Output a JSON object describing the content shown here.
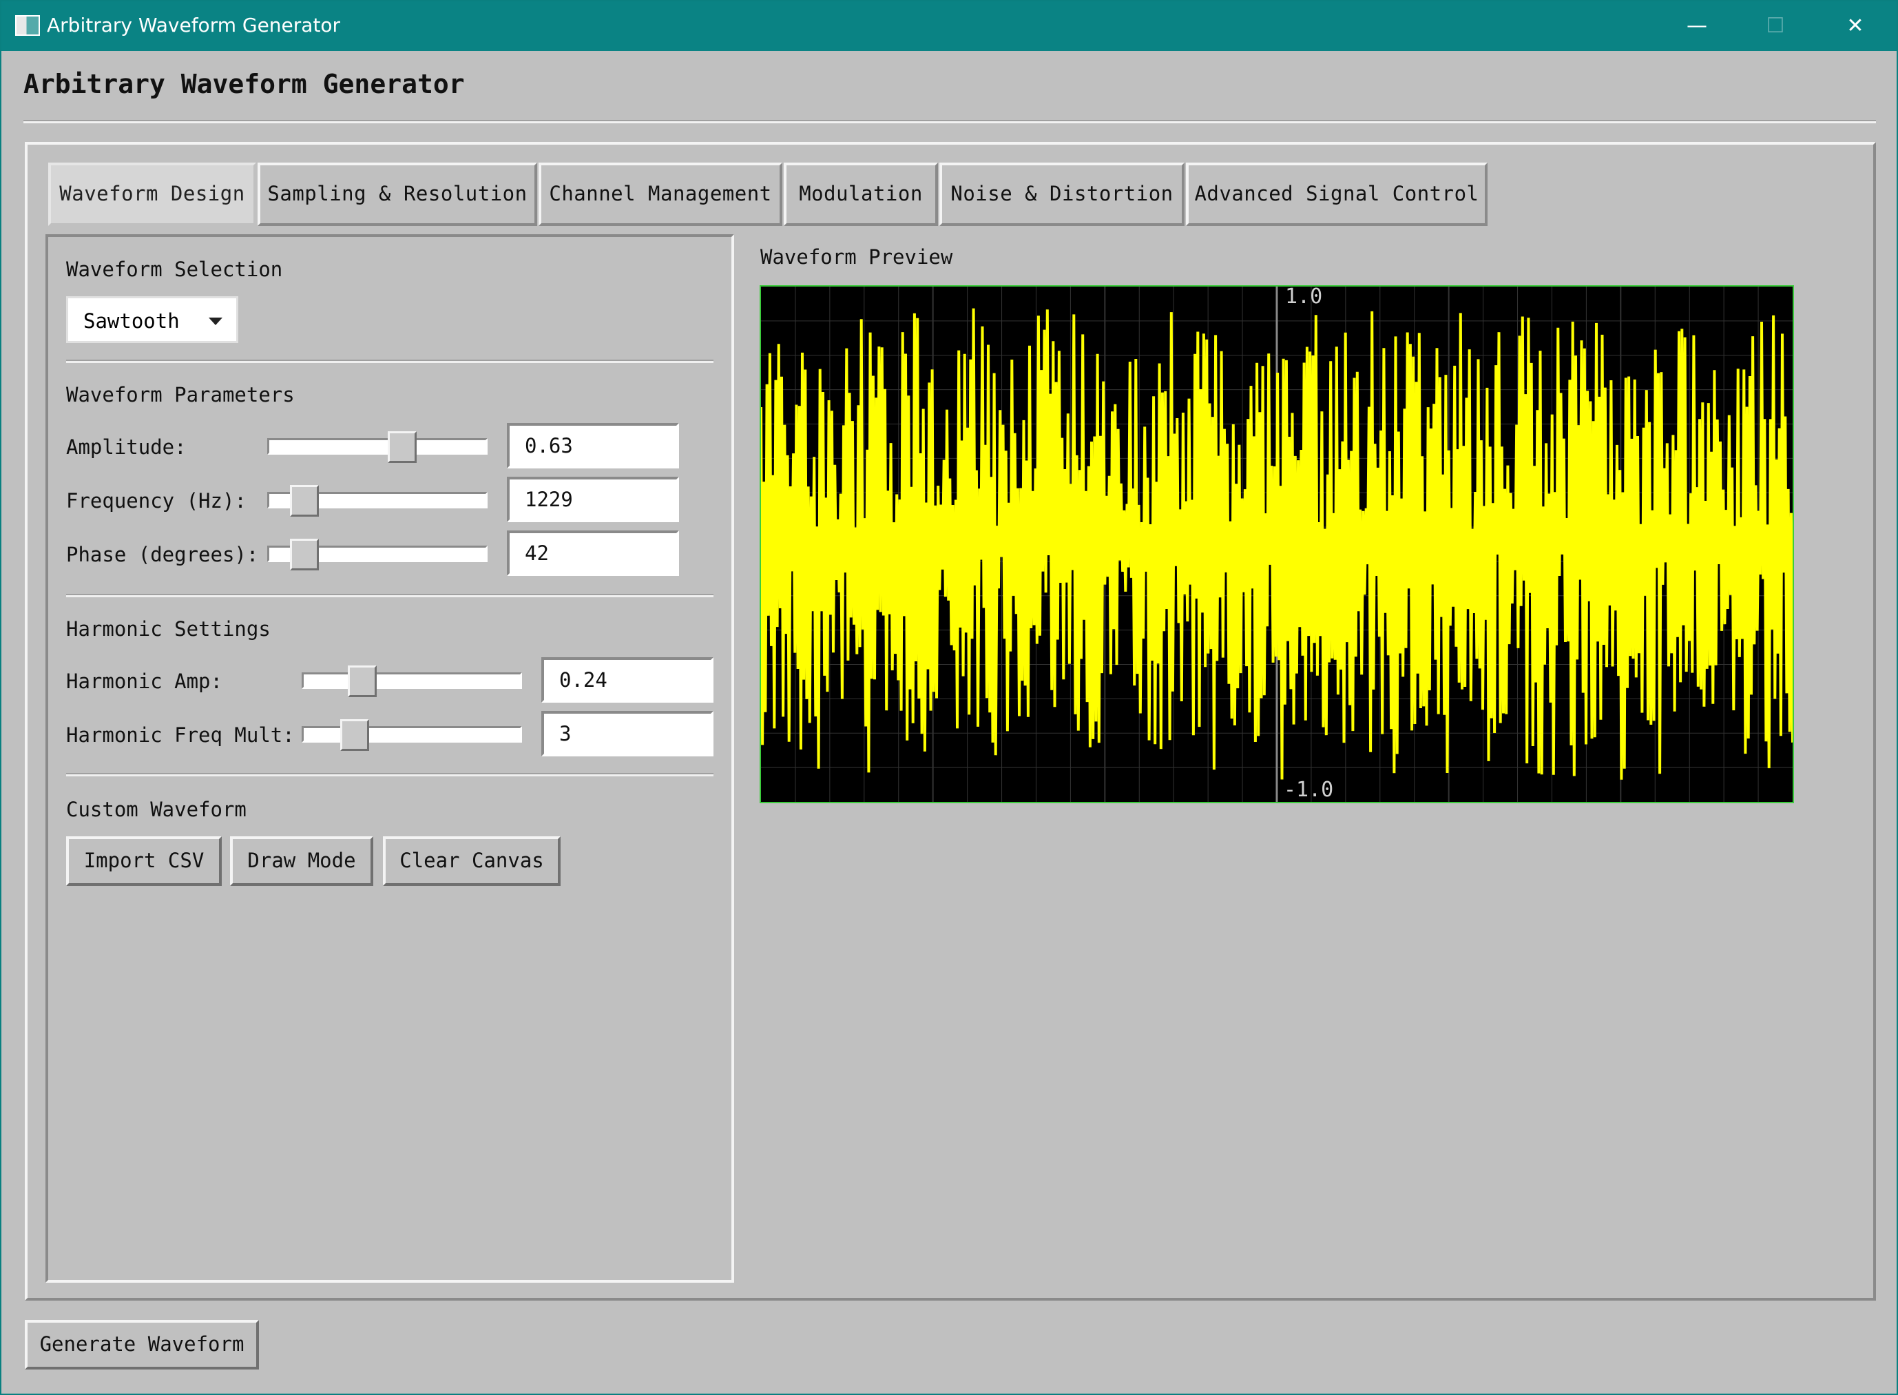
{
  "window": {
    "title": "Arbitrary Waveform Generator",
    "controls": {
      "minimize": "—",
      "maximize": "☐",
      "close": "✕"
    }
  },
  "app": {
    "title": "Arbitrary Waveform Generator"
  },
  "tabs": [
    {
      "label": "Waveform Design",
      "active": true
    },
    {
      "label": "Sampling & Resolution",
      "active": false
    },
    {
      "label": "Channel Management",
      "active": false
    },
    {
      "label": "Modulation",
      "active": false
    },
    {
      "label": "Noise & Distortion",
      "active": false
    },
    {
      "label": "Advanced Signal Control",
      "active": false
    }
  ],
  "waveform_selection": {
    "heading": "Waveform Selection",
    "selected": "Sawtooth"
  },
  "waveform_parameters": {
    "heading": "Waveform Parameters",
    "amplitude": {
      "label": "Amplitude:",
      "value": "0.63",
      "slider_level": 0.63
    },
    "frequency": {
      "label": "Frequency (Hz):",
      "value": "1229",
      "slider_level": 0.12
    },
    "phase": {
      "label": "Phase (degrees):",
      "value": "42",
      "slider_level": 0.117
    }
  },
  "harmonic_settings": {
    "heading": "Harmonic Settings",
    "harmonic_amp": {
      "label": "Harmonic Amp:",
      "value": "0.24",
      "slider_level": 0.24
    },
    "harmonic_freq_mult": {
      "label": "Harmonic Freq Mult:",
      "value": "3",
      "slider_level": 0.2
    }
  },
  "custom_waveform": {
    "heading": "Custom Waveform",
    "import_label": "Import CSV",
    "draw_label": "Draw Mode",
    "clear_label": "Clear Canvas"
  },
  "preview": {
    "title": "Waveform Preview",
    "chart_data": {
      "type": "line",
      "y_max_label": "1.0",
      "y_min_label": "-1.0",
      "ylim": [
        -1.0,
        1.0
      ],
      "grid": true,
      "series_color": "#ffff00",
      "grid_color": "#333333",
      "axis_color": "#888888",
      "border_color": "#3ccc3c"
    }
  },
  "footer": {
    "generate_label": "Generate Waveform"
  }
}
